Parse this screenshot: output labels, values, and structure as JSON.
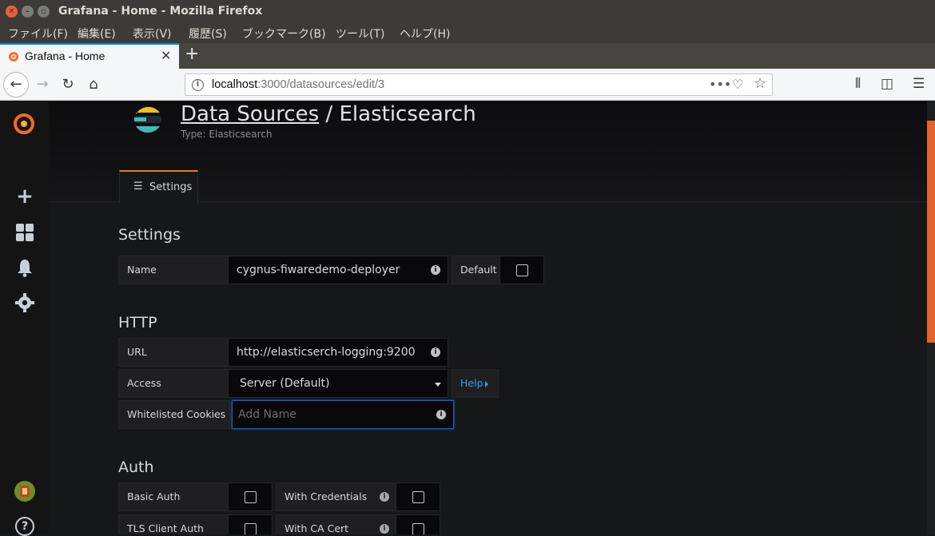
{
  "window": {
    "title": "Grafana - Home - Mozilla Firefox"
  },
  "menu": [
    "ファイル(F)",
    "編集(E)",
    "表示(V)",
    "履歴(S)",
    "ブックマーク(B)",
    "ツール(T)",
    "ヘルプ(H)"
  ],
  "tab": {
    "title": "Grafana - Home"
  },
  "urlbar": {
    "host": "localhost",
    "path": ":3000/datasources/edit/3"
  },
  "page": {
    "title_link": "Data Sources",
    "title_sep": " / ",
    "title_name": "Elasticsearch",
    "subtitle": "Type: Elasticsearch",
    "tab_settings": "Settings"
  },
  "settings": {
    "heading": "Settings",
    "name_label": "Name",
    "name_value": "cygnus-fiwaredemo-deployer",
    "default_label": "Default"
  },
  "http": {
    "heading": "HTTP",
    "url_label": "URL",
    "url_value": "http://elasticserch-logging:9200",
    "access_label": "Access",
    "access_value": "Server (Default)",
    "help_label": "Help",
    "cookies_label": "Whitelisted Cookies",
    "cookies_placeholder": "Add Name"
  },
  "auth": {
    "heading": "Auth",
    "basic_label": "Basic Auth",
    "credentials_label": "With Credentials",
    "tls_label": "TLS Client Auth",
    "cacert_label": "With CA Cert"
  },
  "colors": {
    "accent": "#eb7b18",
    "link": "#33a2e5"
  }
}
